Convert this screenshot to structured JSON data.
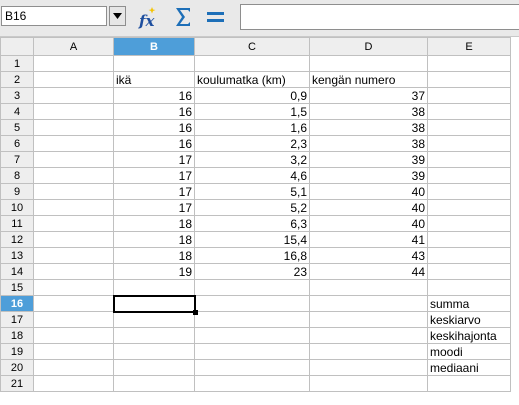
{
  "formula_bar": {
    "namebox_value": "B16",
    "formula_value": ""
  },
  "icons": [
    "dropdown-arrow-icon",
    "function-wizard-icon",
    "sum-icon",
    "equals-icon"
  ],
  "columns": [
    "A",
    "B",
    "C",
    "D",
    "E"
  ],
  "selected": {
    "column": "B",
    "row": "16",
    "cell": "B16"
  },
  "rows": [
    {
      "n": "1",
      "A": "",
      "B": "",
      "C": "",
      "D": "",
      "E": ""
    },
    {
      "n": "2",
      "A": "",
      "B": "ikä",
      "C": "koulumatka (km)",
      "D": "kengän numero",
      "E": ""
    },
    {
      "n": "3",
      "A": "",
      "B": "16",
      "C": "0,9",
      "D": "37",
      "E": ""
    },
    {
      "n": "4",
      "A": "",
      "B": "16",
      "C": "1,5",
      "D": "38",
      "E": ""
    },
    {
      "n": "5",
      "A": "",
      "B": "16",
      "C": "1,6",
      "D": "38",
      "E": ""
    },
    {
      "n": "6",
      "A": "",
      "B": "16",
      "C": "2,3",
      "D": "38",
      "E": ""
    },
    {
      "n": "7",
      "A": "",
      "B": "17",
      "C": "3,2",
      "D": "39",
      "E": ""
    },
    {
      "n": "8",
      "A": "",
      "B": "17",
      "C": "4,6",
      "D": "39",
      "E": ""
    },
    {
      "n": "9",
      "A": "",
      "B": "17",
      "C": "5,1",
      "D": "40",
      "E": ""
    },
    {
      "n": "10",
      "A": "",
      "B": "17",
      "C": "5,2",
      "D": "40",
      "E": ""
    },
    {
      "n": "11",
      "A": "",
      "B": "18",
      "C": "6,3",
      "D": "40",
      "E": ""
    },
    {
      "n": "12",
      "A": "",
      "B": "18",
      "C": "15,4",
      "D": "41",
      "E": ""
    },
    {
      "n": "13",
      "A": "",
      "B": "18",
      "C": "16,8",
      "D": "43",
      "E": ""
    },
    {
      "n": "14",
      "A": "",
      "B": "19",
      "C": "23",
      "D": "44",
      "E": ""
    },
    {
      "n": "15",
      "A": "",
      "B": "",
      "C": "",
      "D": "",
      "E": ""
    },
    {
      "n": "16",
      "A": "",
      "B": "",
      "C": "",
      "D": "",
      "E": "summa"
    },
    {
      "n": "17",
      "A": "",
      "B": "",
      "C": "",
      "D": "",
      "E": "keskiarvo"
    },
    {
      "n": "18",
      "A": "",
      "B": "",
      "C": "",
      "D": "",
      "E": "keskihajonta"
    },
    {
      "n": "19",
      "A": "",
      "B": "",
      "C": "",
      "D": "",
      "E": "moodi"
    },
    {
      "n": "20",
      "A": "",
      "B": "",
      "C": "",
      "D": "",
      "E": "mediaani"
    },
    {
      "n": "21",
      "A": "",
      "B": "",
      "C": "",
      "D": "",
      "E": ""
    }
  ],
  "colors": {
    "header_selected": "#4e9ed9",
    "header_bg": "#eeeeee",
    "grid_line": "#c0c0c0",
    "toolbar_bg": "#e9e9e9"
  }
}
